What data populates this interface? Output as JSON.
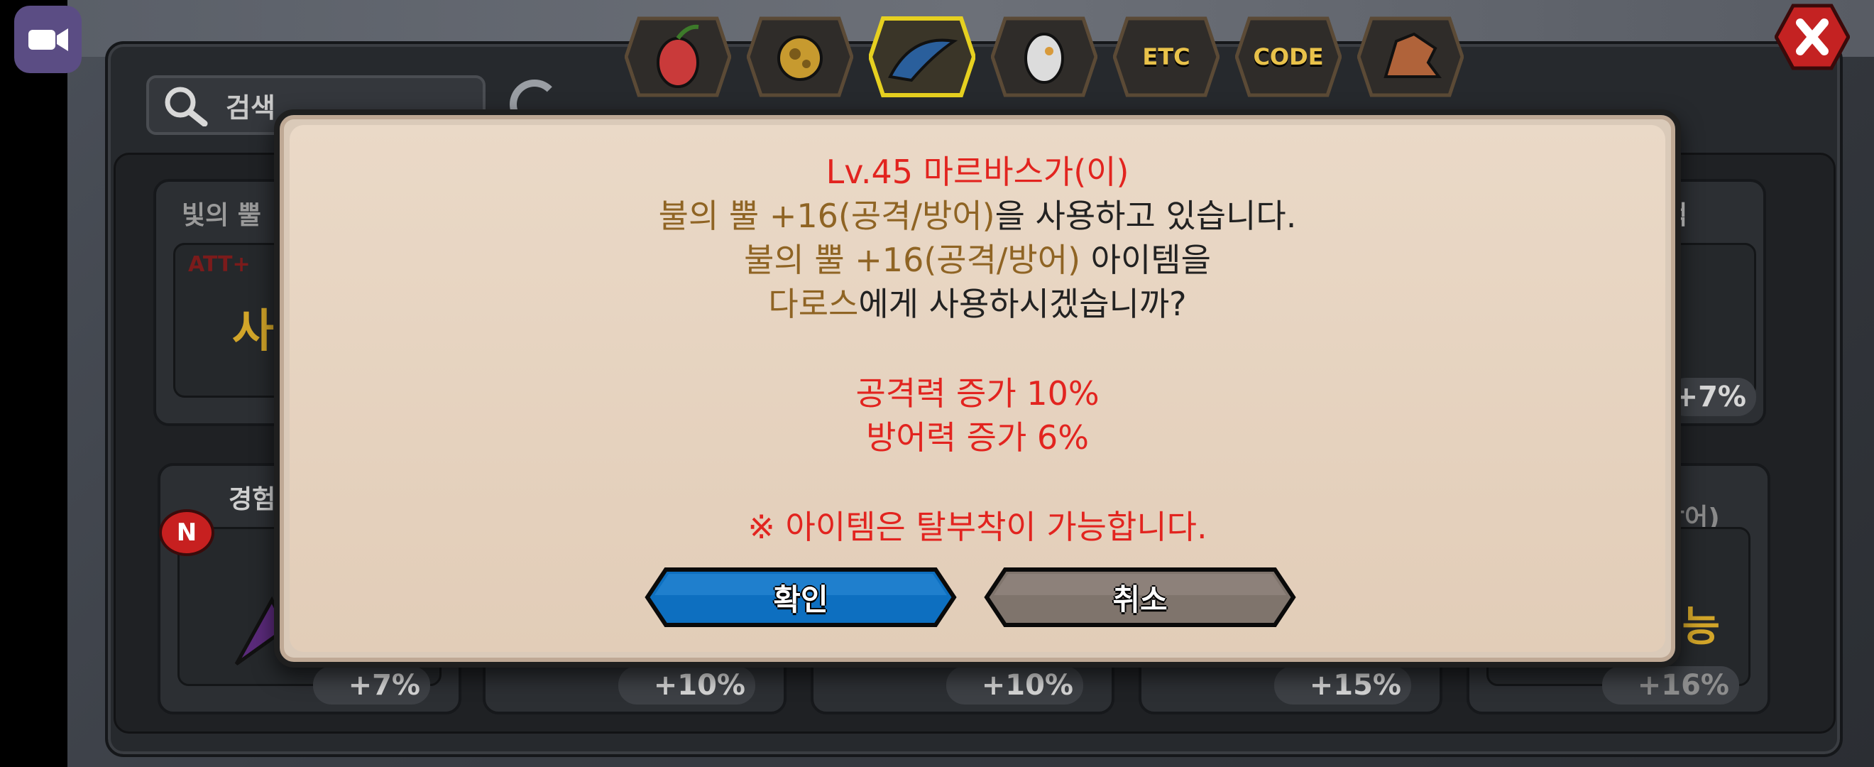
{
  "search": {
    "placeholder": "검색"
  },
  "tabs": [
    {
      "id": "fruit",
      "icon": "fruit-icon",
      "label": ""
    },
    {
      "id": "material",
      "icon": "ore-icon",
      "label": ""
    },
    {
      "id": "horn",
      "icon": "horn-icon",
      "label": "",
      "active": true
    },
    {
      "id": "egg",
      "icon": "egg-icon",
      "label": ""
    },
    {
      "id": "etc",
      "icon": "",
      "label": "ETC"
    },
    {
      "id": "code",
      "icon": "",
      "label": "CODE"
    },
    {
      "id": "dragon",
      "icon": "dragon-icon",
      "label": ""
    }
  ],
  "background": {
    "card_top_left_title": "빛의 뿔",
    "card_top_left_attr": "ATT+",
    "card_top_left_glyph": "사",
    "card_top_right_title": "적",
    "card_top_right_pct": "+7%",
    "card_bottom_left_title": "경험",
    "card_bottom_right_title": "방어)",
    "card_bottom_right_glyph": "능",
    "badge_new": "N",
    "bottom_pcts": [
      "+7%",
      "+10%",
      "+10%",
      "+15%",
      "+16%"
    ]
  },
  "dialog": {
    "line1": "Lv.45 마르바스가(이)",
    "line2_item": "불의 뿔 +16(공격/방어)",
    "line2_rest": "을 사용하고 있습니다.",
    "line3_item": "불의 뿔 +16(공격/방어)",
    "line3_rest": " 아이템을",
    "line4_target": "다로스",
    "line4_rest": "에게 사용하시겠습니까?",
    "stat1": "공격력 증가 10%",
    "stat2": "방어력 증가 6%",
    "note": "※ 아이템은 탈부착이 가능합니다.",
    "confirm_label": "확인",
    "cancel_label": "취소"
  },
  "colors": {
    "dialog_bg": "#e6d4c0",
    "red_text": "#e2241f",
    "brown_text": "#8f6424",
    "confirm_button": "#0d6fc0",
    "cancel_button": "#7f746c"
  }
}
